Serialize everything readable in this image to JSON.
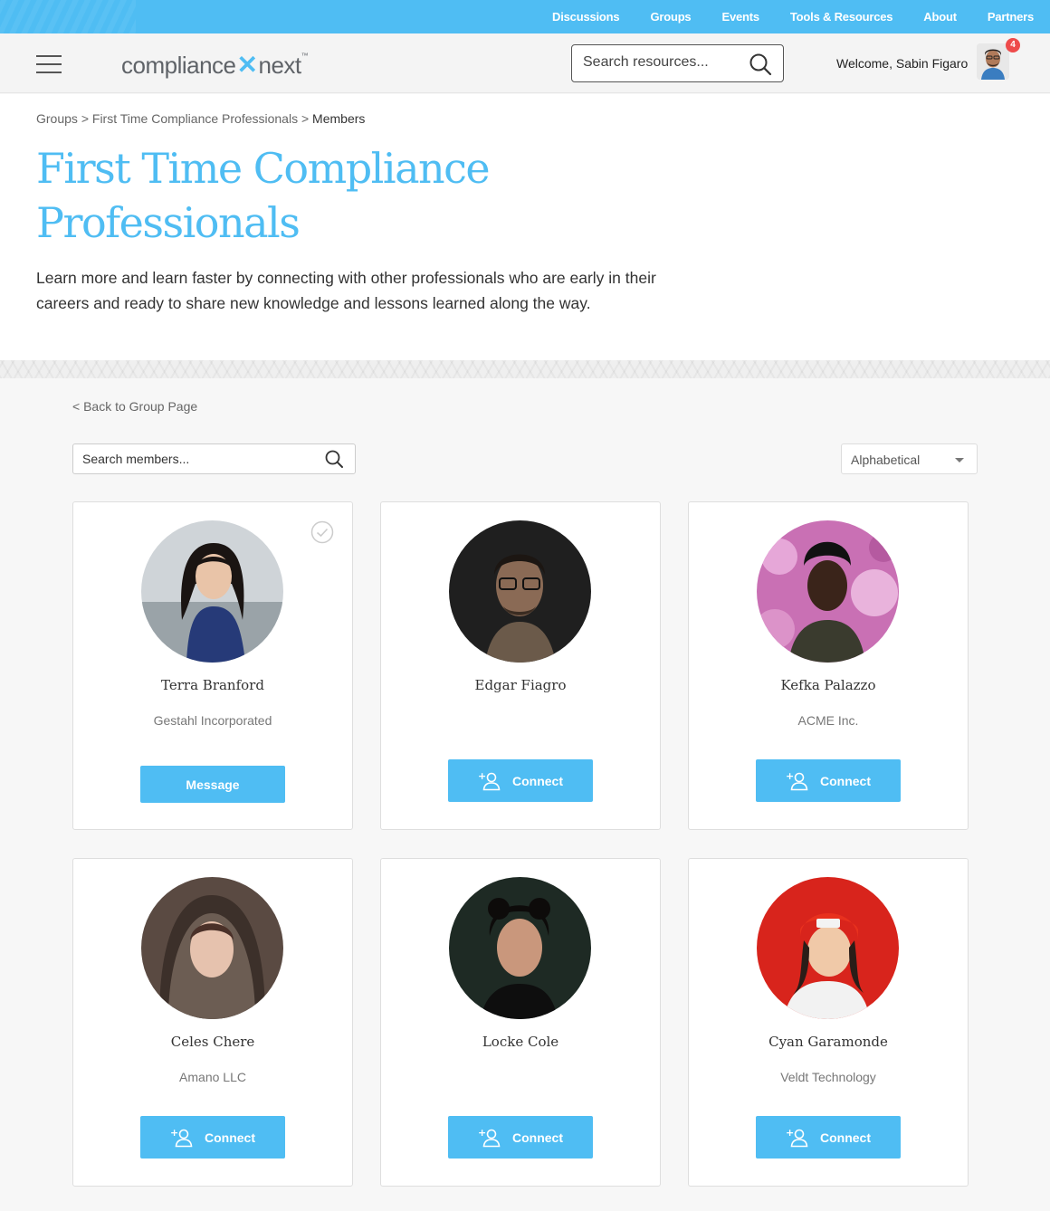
{
  "topnav": [
    "Discussions",
    "Groups",
    "Events",
    "Tools & Resources",
    "About",
    "Partners"
  ],
  "header": {
    "logo_left": "compliance",
    "logo_right": "next",
    "logo_tm": "™",
    "search_placeholder": "Search resources...",
    "welcome": "Welcome, Sabin Figaro",
    "notification_count": "4"
  },
  "breadcrumb": {
    "item1": "Groups",
    "sep": ">",
    "item2": "First Time Compliance Professionals",
    "current": "Members"
  },
  "page": {
    "title": "First Time Compliance Professionals",
    "description": "Learn more and learn faster by connecting with other professionals who are early in their careers and ready to share new knowledge and lessons learned along the way."
  },
  "members_area": {
    "back_link": "< Back to Group Page",
    "search_placeholder": "Search members...",
    "sort_value": "Alphabetical"
  },
  "members": [
    {
      "name": "Terra Branford",
      "company": "Gestahl Incorporated",
      "action": "Message",
      "connected": true
    },
    {
      "name": "Edgar Fiagro",
      "company": "",
      "action": "Connect",
      "connected": false
    },
    {
      "name": "Kefka Palazzo",
      "company": "ACME Inc.",
      "action": "Connect",
      "connected": false
    },
    {
      "name": "Celes Chere",
      "company": "Amano LLC",
      "action": "Connect",
      "connected": false
    },
    {
      "name": "Locke Cole",
      "company": "",
      "action": "Connect",
      "connected": false
    },
    {
      "name": "Cyan Garamonde",
      "company": "Veldt Technology",
      "action": "Connect",
      "connected": false
    }
  ],
  "colors": {
    "accent": "#4fbdf3",
    "badge": "#ee4b4b"
  },
  "icons": {
    "search": "search-icon",
    "add_user": "add-user-icon",
    "check": "check-circle-icon",
    "menu": "hamburger-icon"
  }
}
